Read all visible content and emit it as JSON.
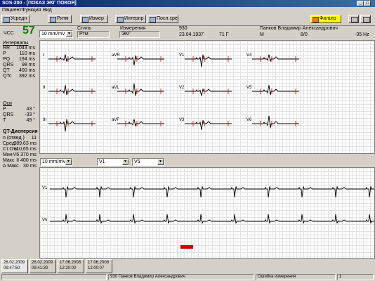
{
  "window": {
    "title": "SDS-200 - [ПОКАЗ ЭКГ ПОКОЯ]"
  },
  "menu": [
    "Пациент",
    "Функция",
    "Вид"
  ],
  "toolbar": {
    "buttons": [
      "Усредн",
      "Ритм",
      "Измер",
      "Интерпр",
      "Посл.сре"
    ],
    "filter_label": "Фильтр"
  },
  "header": {
    "hr_label": "ЧСС",
    "hr_value": "57",
    "speed_select": "10 mm/mV",
    "style_label": "Стиль",
    "style_value": "Ртм",
    "measurement_label": "Измерения",
    "measurement_value": "ЭКГ",
    "patient_id": "930",
    "birth_date": "23.04.1937",
    "age": "71 Г",
    "patient_name": "Панков Владимир Александрович",
    "sex": "М",
    "ratio": "8/0",
    "filter_hz": "-35 Hz"
  },
  "intervals": {
    "title": "Интервалы",
    "rows": [
      {
        "name": "RR",
        "value": "1043 ms"
      },
      {
        "name": "P",
        "value": "110 ms"
      },
      {
        "name": "PQ",
        "value": "194 ms"
      },
      {
        "name": "QRS",
        "value": "98 ms"
      },
      {
        "name": "QT",
        "value": "400 ms"
      },
      {
        "name": "QTc",
        "value": "392 ms"
      }
    ]
  },
  "axes": {
    "title": "Оси",
    "rows": [
      {
        "name": "P",
        "value": "43 °"
      },
      {
        "name": "QRS",
        "value": "-33 °"
      },
      {
        "name": "T",
        "value": "49 °"
      }
    ]
  },
  "qt_dispersion": {
    "title": "QT-Дисперсия",
    "rows": [
      {
        "name": "n (отвед.)",
        "value": "11"
      },
      {
        "name": "Сред.",
        "value": "389,63 ms"
      },
      {
        "name": "Ст.Отк.",
        "value": "±10,65 ms"
      },
      {
        "name": "Мин",
        "value": "V6 370 ms"
      },
      {
        "name": "Макс",
        "value": "II 400 ms"
      },
      {
        "name": "Δ Макс",
        "value": "30 ms"
      }
    ]
  },
  "leads": [
    "I",
    "aVR",
    "V1",
    "V4",
    "II",
    "aVL",
    "V2",
    "V5",
    "III",
    "aVF",
    "V3",
    "V6"
  ],
  "rhythm": {
    "speed_select": "10 mm/mV",
    "lead1_select": "V1",
    "lead2_select": "V5",
    "lead1_label": "V1",
    "lead2_label": "V5"
  },
  "tabs": [
    {
      "date": "28.02.2009",
      "time": "09:47:50"
    },
    {
      "date": "28.02.2009",
      "time": "09:41:30"
    },
    {
      "date": "17.06.2008",
      "time": "12:20:00"
    },
    {
      "date": "17.06.2008",
      "time": "12:00:07"
    }
  ],
  "status": {
    "patient": "930  Панков Владимир Александрович",
    "message": "Ошибка измерения",
    "page": "1"
  },
  "colors": {
    "hr": "#008000",
    "trace": "#000000",
    "marker": "#cc0000",
    "filter_button": "#ffff00"
  }
}
